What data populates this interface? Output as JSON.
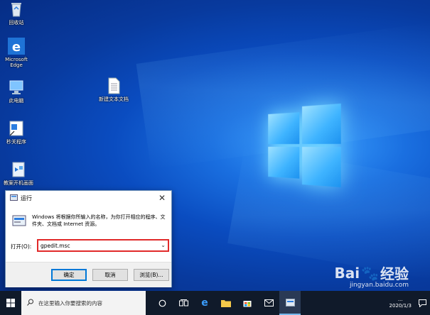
{
  "desktop": {
    "icons": [
      {
        "label": "回收站"
      },
      {
        "label": "Microsoft Edge"
      },
      {
        "label": "此电脑"
      },
      {
        "label": "新建文本文档"
      },
      {
        "label": "秒关程序"
      },
      {
        "label": "教案开机画面"
      }
    ]
  },
  "run_dialog": {
    "title": "运行",
    "description": "Windows 将根据你所输入的名称，为你打开相应的程序、文件夹、文档或 Internet 资源。",
    "open_label": "打开(O):",
    "input_value": "gpedit.msc",
    "ok_label": "确定",
    "cancel_label": "取消",
    "browse_label": "浏览(B)..."
  },
  "taskbar": {
    "search_placeholder": "在这里输入你要搜索的内容",
    "clock_time": "...",
    "clock_date": "2020/1/3"
  },
  "watermark": {
    "brand": "Bai",
    "brand_suffix": "经验",
    "url": "jingyan.baidu.com"
  },
  "colors": {
    "accent": "#0078d7",
    "highlight_border": "#e12a2a",
    "taskbar": "#101a2a"
  }
}
